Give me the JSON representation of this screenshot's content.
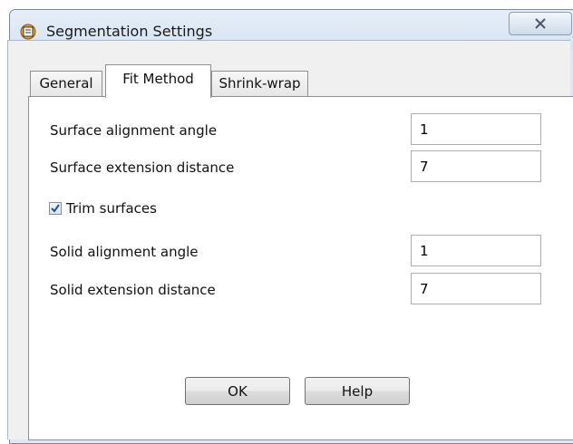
{
  "window": {
    "title": "Segmentation Settings",
    "close_glyph": "✕"
  },
  "tabs": [
    {
      "label": "General",
      "active": false
    },
    {
      "label": "Fit Method",
      "active": true
    },
    {
      "label": "Shrink-wrap",
      "active": false
    }
  ],
  "form": {
    "surface_alignment_angle": {
      "label": "Surface alignment angle",
      "value": "1"
    },
    "surface_extension_distance": {
      "label": "Surface extension distance",
      "value": "7"
    },
    "trim_surfaces": {
      "label": "Trim surfaces",
      "checked": true
    },
    "solid_alignment_angle": {
      "label": "Solid alignment angle",
      "value": "1"
    },
    "solid_extension_distance": {
      "label": "Solid extension distance",
      "value": "7"
    }
  },
  "buttons": {
    "ok": "OK",
    "help": "Help"
  },
  "icons": {
    "app": "app-icon",
    "close": "close-icon",
    "check": "checkmark-icon"
  },
  "colors": {
    "title_bar": "#dde8f4",
    "panel": "#ffffff",
    "check": "#2a4d8c"
  }
}
